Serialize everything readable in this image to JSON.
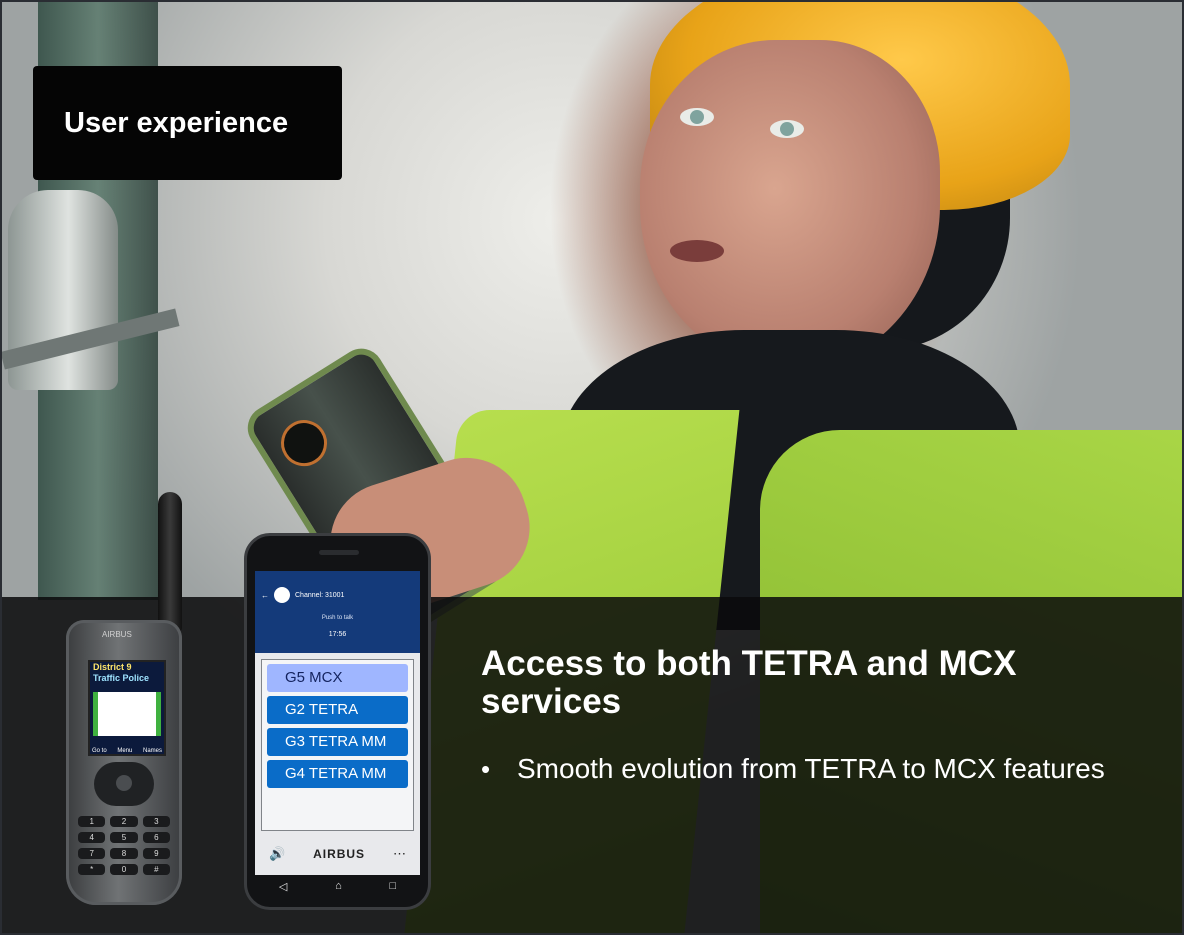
{
  "slide": {
    "title": "User experience",
    "heading": "Access to both TETRA and MCX services",
    "bullets": [
      {
        "marker": "•",
        "text": "Smooth evolution from TETRA to MCX features"
      }
    ]
  },
  "radio_device": {
    "brand": "AIRBUS",
    "screen_lines": [
      "District 9",
      "Traffic Police"
    ],
    "softkeys": [
      "Go to",
      "Menu",
      "Names"
    ],
    "keys": [
      "1",
      "2",
      "3",
      "4",
      "5",
      "6",
      "7",
      "8",
      "9",
      "*",
      "0",
      "#"
    ]
  },
  "phone_device": {
    "status_bar": "",
    "channel": "Channel: 31001",
    "ptt_hint": "Push to talk",
    "time": "17:56",
    "groups": [
      {
        "label": "G5 MCX",
        "selected": true
      },
      {
        "label": "G2 TETRA",
        "selected": false
      },
      {
        "label": "G3 TETRA MM",
        "selected": false
      },
      {
        "label": "G4 TETRA MM",
        "selected": false
      }
    ],
    "bottom_bar": {
      "volume_icon": "speaker-icon",
      "brand": "AIRBUS",
      "more_icon": "more-icon"
    },
    "nav_icons": [
      "back-icon",
      "home-icon",
      "recents-icon"
    ]
  },
  "colors": {
    "title_box_bg": "#050505",
    "overlay_bg": "#0a0a0c",
    "group_item": "#0a6cc8",
    "group_selected": "#9fb6ff",
    "phone_header": "#143a7a"
  }
}
